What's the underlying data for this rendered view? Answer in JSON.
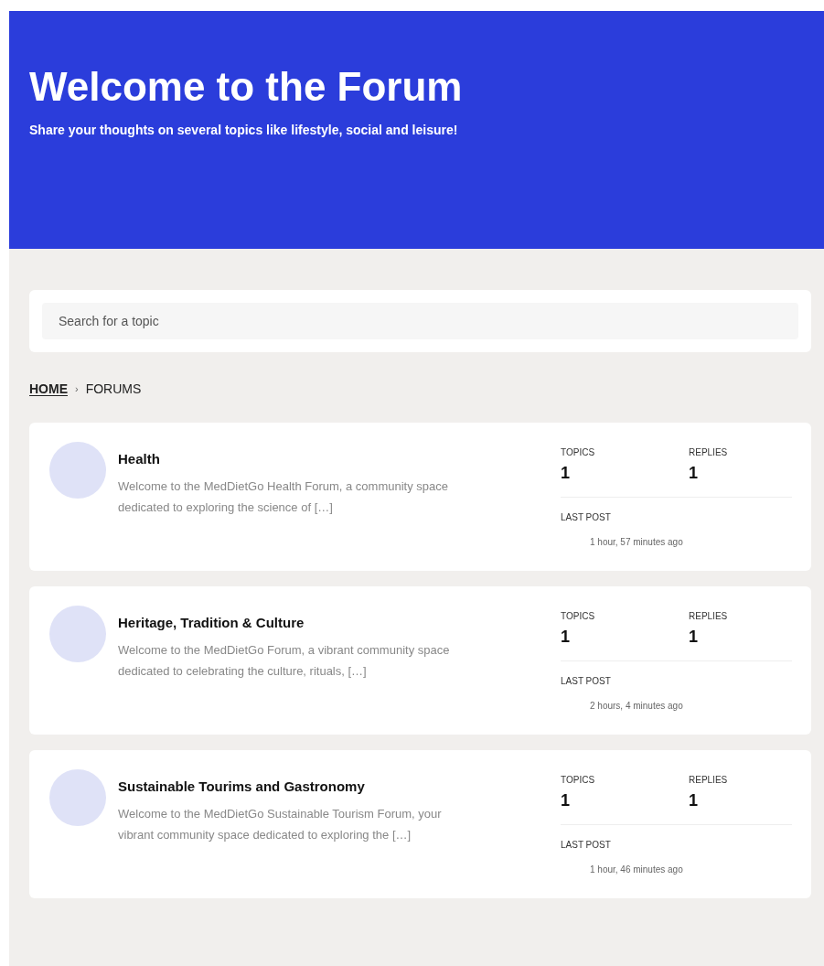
{
  "header": {
    "title": "Welcome to the Forum",
    "subtitle": "Share your thoughts on several topics like lifestyle, social and leisure!"
  },
  "search": {
    "placeholder": "Search for a topic"
  },
  "breadcrumb": [
    {
      "label": "HOME",
      "kind": "link"
    },
    {
      "label": "›",
      "kind": "separator"
    },
    {
      "label": "FORUMS",
      "kind": "current"
    }
  ],
  "forums": [
    {
      "title": "Health",
      "description": "Welcome to the MedDietGo Health Forum, a community space dedicated to exploring the science of […]",
      "topics_label": "TOPICS",
      "topics": "1",
      "replies_label": "REPLIES",
      "replies": "1",
      "last_post_label": "LAST POST",
      "last_post": "1 hour, 57 minutes ago"
    },
    {
      "title": "Heritage, Tradition & Culture",
      "description": "Welcome to the MedDietGo Forum, a vibrant community space dedicated to celebrating the culture, rituals, […]",
      "topics_label": "TOPICS",
      "topics": "1",
      "replies_label": "REPLIES",
      "replies": "1",
      "last_post_label": "LAST POST",
      "last_post": "2 hours, 4 minutes ago"
    },
    {
      "title": "Sustainable Tourims and Gastronomy",
      "description": "Welcome to the MedDietGo Sustainable Tourism Forum, your vibrant community space dedicated to exploring the […]",
      "topics_label": "TOPICS",
      "topics": "1",
      "replies_label": "REPLIES",
      "replies": "1",
      "last_post_label": "LAST POST",
      "last_post": "1 hour, 46 minutes ago"
    }
  ]
}
